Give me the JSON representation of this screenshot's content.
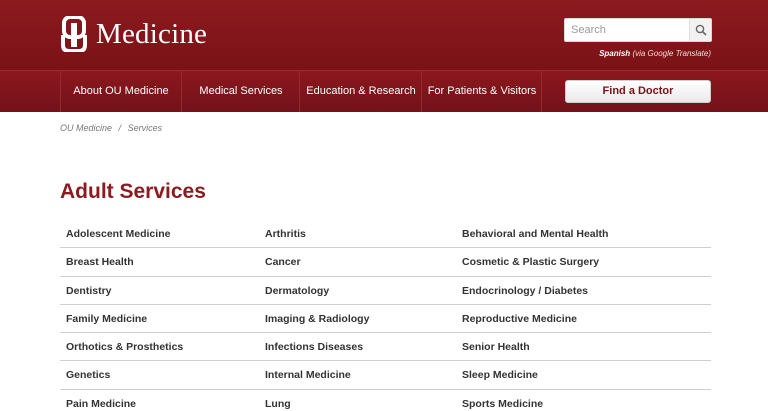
{
  "brand": {
    "logo_text": "Medicine",
    "colors": {
      "primary": "#8c1a1f",
      "nav": "#7a1216"
    }
  },
  "search": {
    "placeholder": "Search",
    "icon": "search-icon"
  },
  "translate": {
    "language": "Spanish",
    "via": "(via Google Translate)"
  },
  "nav": {
    "items": [
      "About OU Medicine",
      "Medical Services",
      "Education & Research",
      "For Patients & Visitors"
    ],
    "cta": "Find a Doctor"
  },
  "breadcrumb": {
    "home": "OU Medicine",
    "separator": "/",
    "current": "Services"
  },
  "section": {
    "title": "Adult Services"
  },
  "services": {
    "rows": [
      [
        "Adolescent Medicine",
        "Arthritis",
        "Behavioral and Mental Health"
      ],
      [
        "Breast Health",
        "Cancer",
        "Cosmetic & Plastic Surgery"
      ],
      [
        "Dentistry",
        "Dermatology",
        "Endocrinology / Diabetes"
      ],
      [
        "Family Medicine",
        "Imaging & Radiology",
        "Reproductive Medicine"
      ],
      [
        "Orthotics & Prosthetics",
        "Infections Diseases",
        "Senior Health"
      ],
      [
        "Genetics",
        "Internal Medicine",
        "Sleep Medicine"
      ],
      [
        "Pain Medicine",
        "Lung",
        "Sports Medicine"
      ]
    ]
  }
}
